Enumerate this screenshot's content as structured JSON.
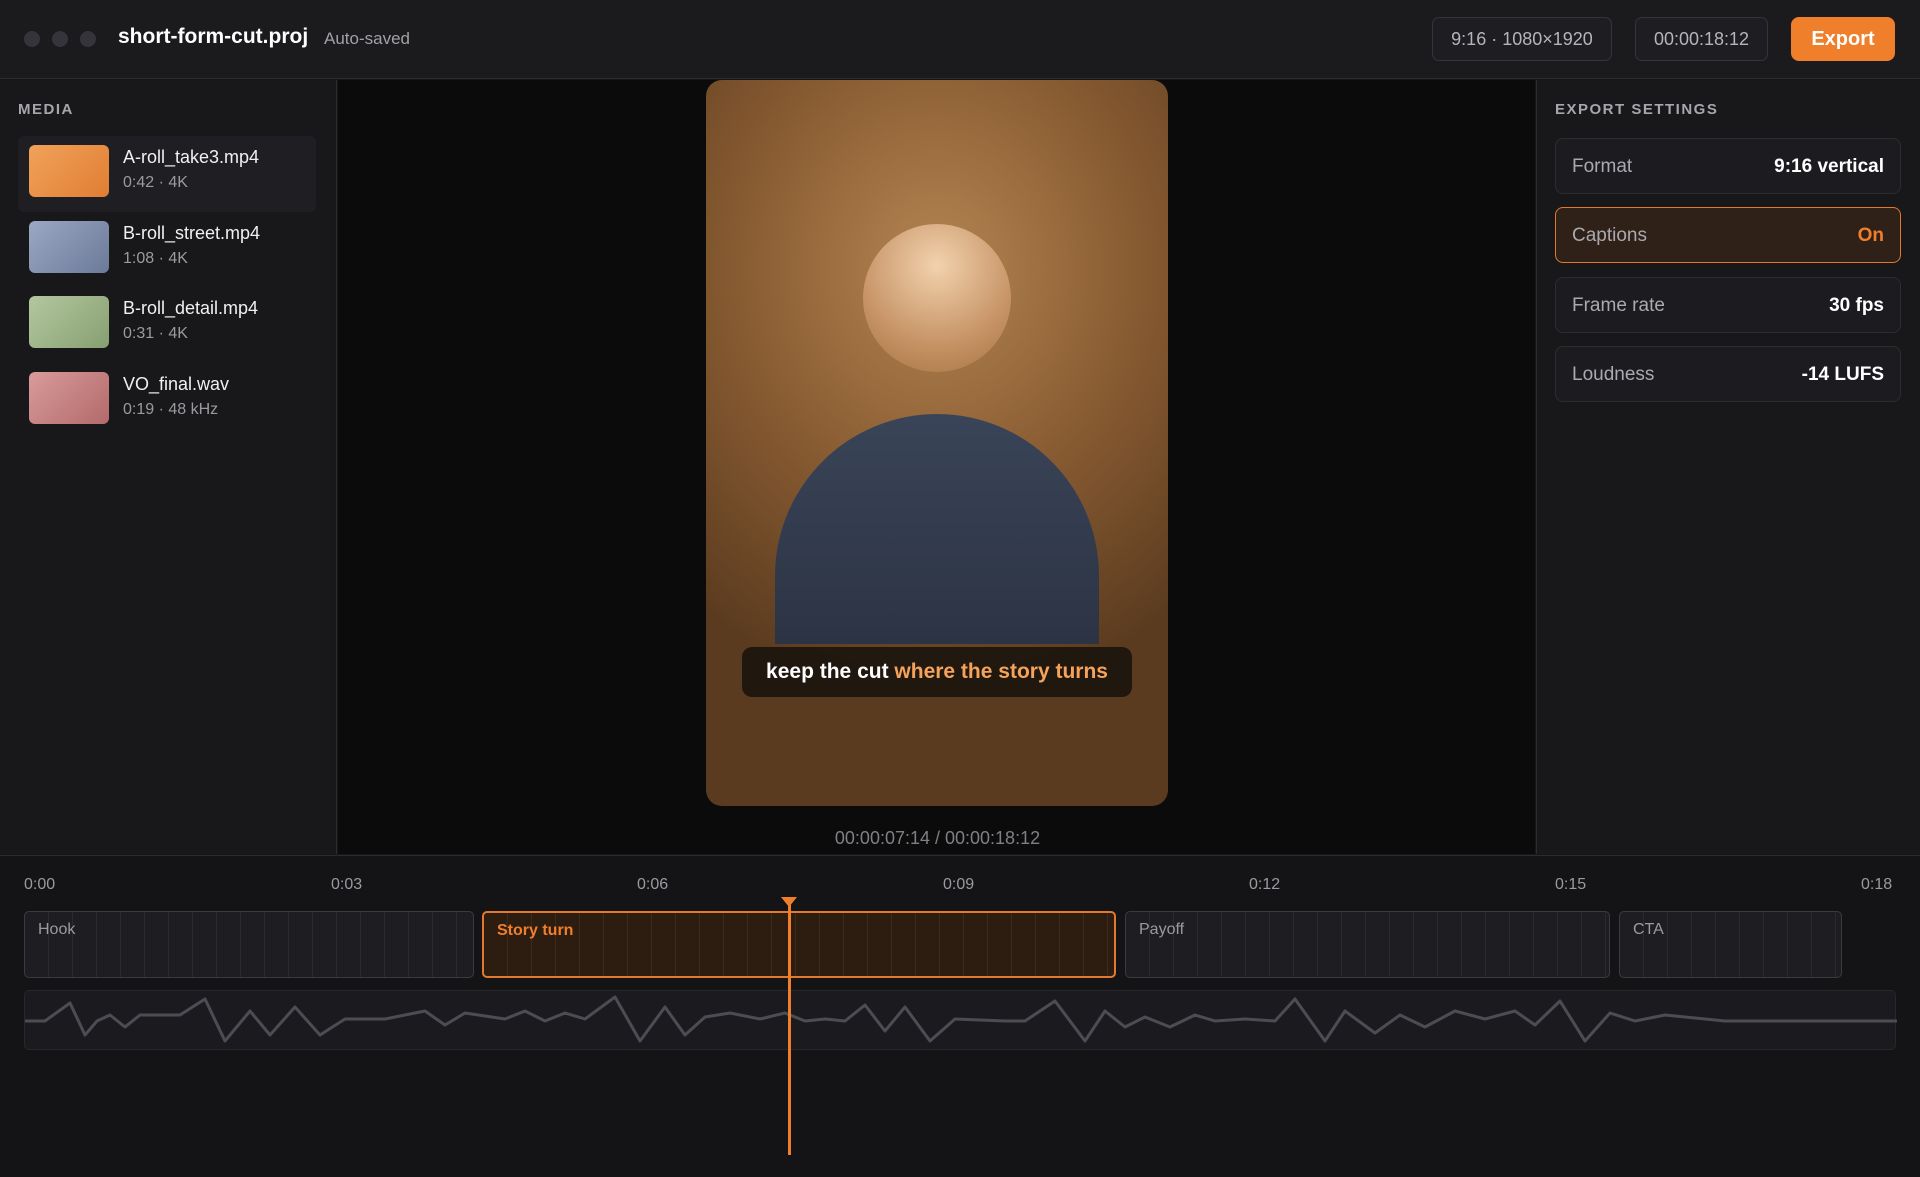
{
  "window": {
    "title": "short-form-cut.proj",
    "status": "Auto-saved",
    "format_pill": "9:16 · 1080×1920",
    "duration_pill": "00:00:18:12",
    "export_label": "Export",
    "accent_color": "#f07f2c"
  },
  "media": {
    "heading": "MEDIA",
    "items": [
      {
        "name": "A-roll_take3.mp4",
        "meta": "0:42 · 4K",
        "color": "#ef9a4f"
      },
      {
        "name": "B-roll_street.mp4",
        "meta": "1:08 · 4K",
        "color": "#8797b6"
      },
      {
        "name": "B-roll_detail.mp4",
        "meta": "0:31 · 4K",
        "color": "#a6bc8f"
      },
      {
        "name": "VO_final.wav",
        "meta": "0:19 · 48 kHz",
        "color": "#cf8a8a"
      }
    ]
  },
  "preview": {
    "caption_plain": "keep the cut ",
    "caption_highlight": "where the story turns",
    "timecode": "00:00:07:14 / 00:00:18:12"
  },
  "export_settings": {
    "heading": "EXPORT SETTINGS",
    "rows": [
      {
        "label": "Format",
        "value": "9:16 vertical"
      },
      {
        "label": "Captions",
        "value": "On"
      },
      {
        "label": "Frame rate",
        "value": "30 fps"
      },
      {
        "label": "Loudness",
        "value": "-14 LUFS"
      }
    ]
  },
  "timeline": {
    "ticks": [
      "0:00",
      "0:03",
      "0:06",
      "0:09",
      "0:12",
      "0:15",
      "0:18"
    ],
    "clips": [
      {
        "label": "Hook"
      },
      {
        "label": "Story turn"
      },
      {
        "label": "Payoff"
      },
      {
        "label": "CTA"
      }
    ],
    "playhead_time": "00:00:07:14"
  }
}
